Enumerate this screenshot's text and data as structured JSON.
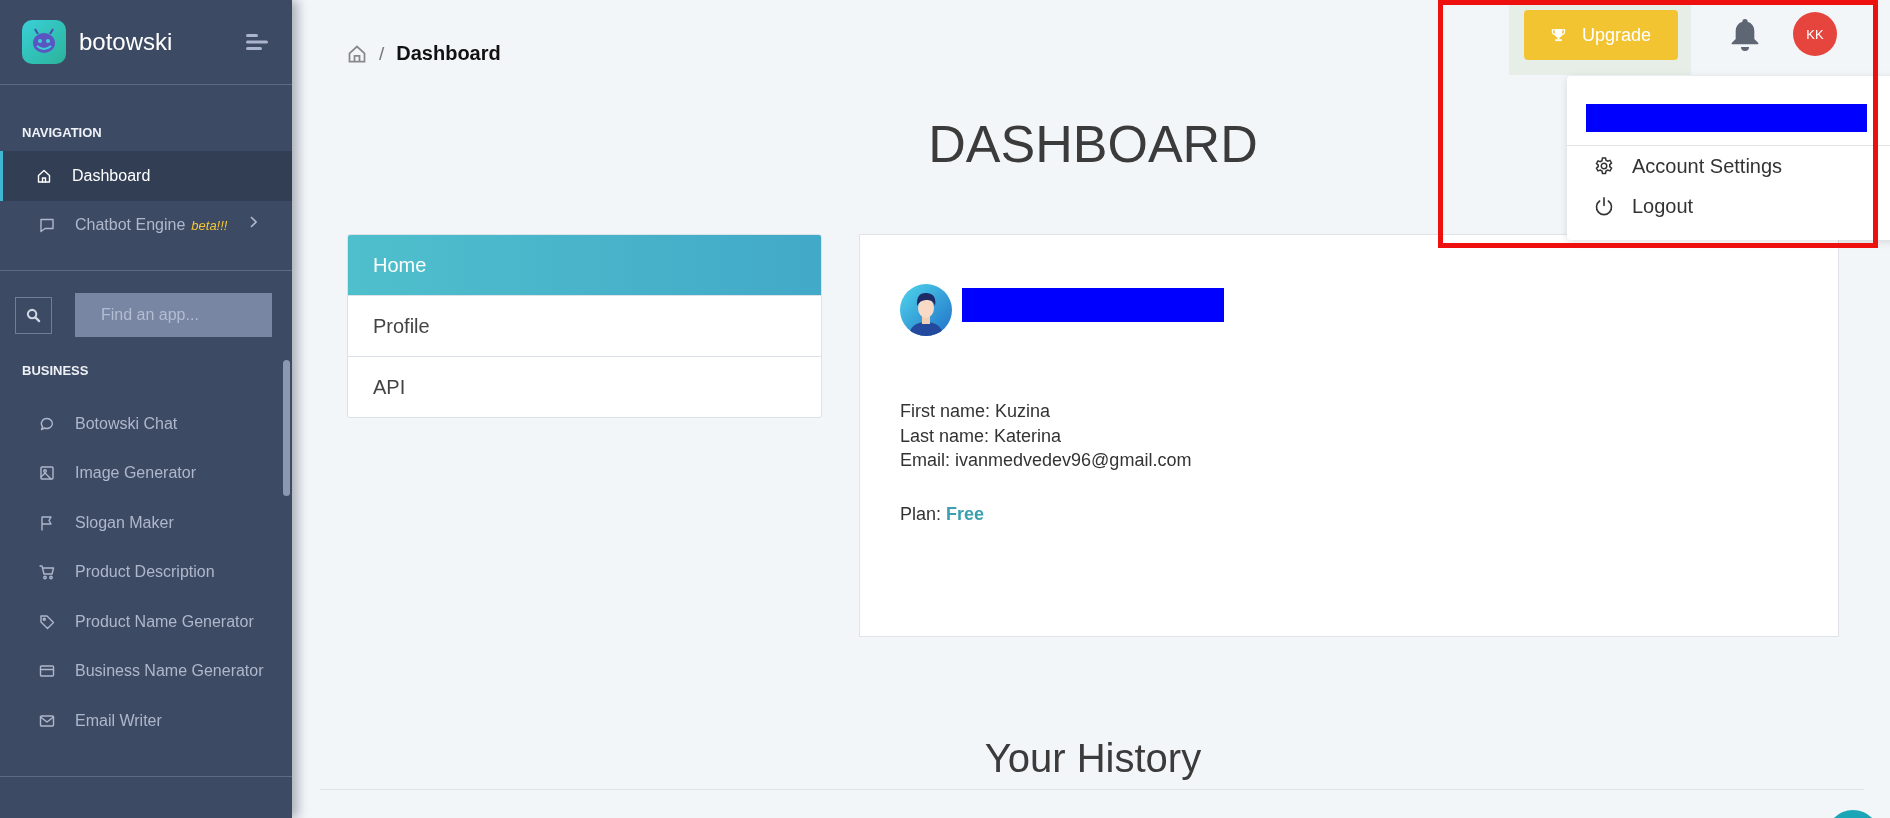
{
  "sidebar": {
    "brand": "botowski",
    "sections": [
      {
        "title": "NAVIGATION",
        "items": [
          {
            "label": "Dashboard",
            "selected": true,
            "expandable": false
          },
          {
            "label": "Chatbot Engine",
            "badge": "beta!!!",
            "selected": false,
            "expandable": true
          }
        ]
      },
      {
        "title": "BUSINESS",
        "items": [
          {
            "label": "Botowski Chat",
            "selected": false,
            "expandable": false
          },
          {
            "label": "Image Generator",
            "selected": false,
            "expandable": false
          },
          {
            "label": "Slogan Maker",
            "selected": false,
            "expandable": false
          },
          {
            "label": "Product Description",
            "selected": false,
            "expandable": false
          },
          {
            "label": "Product Name Generator",
            "selected": false,
            "expandable": false
          },
          {
            "label": "Business Name Generator",
            "selected": false,
            "expandable": false
          },
          {
            "label": "Email Writer",
            "selected": false,
            "expandable": false
          }
        ]
      }
    ],
    "search": {
      "placeholder": "Find an app..."
    }
  },
  "breadcrumb": {
    "separator": "/",
    "current": "Dashboard"
  },
  "header": {
    "upgrade_button": "Upgrade",
    "avatar_initials": "KK",
    "user_menu": {
      "open": true,
      "items": [
        "Account Settings",
        "Logout"
      ]
    }
  },
  "page_title": "DASHBOARD",
  "tabs": [
    {
      "label": "Home",
      "selected": true
    },
    {
      "label": "Profile",
      "selected": false
    },
    {
      "label": "API",
      "selected": false
    }
  ],
  "profile": {
    "lines": [
      "First name: Kuzina",
      "Last name: Katerina",
      "Email: ivanmedvedev96@gmail.com"
    ],
    "plan": "Plan: **Free**"
  },
  "history_title": "Your History"
}
